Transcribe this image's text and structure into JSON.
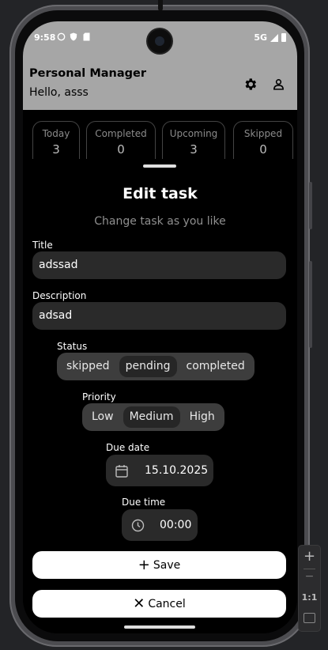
{
  "status_bar": {
    "time": "9:58",
    "network": "5G"
  },
  "app_bar": {
    "title": "Personal Manager",
    "greeting": "Hello, asss",
    "settings_icon": "gear-icon",
    "profile_icon": "person-icon"
  },
  "stats": [
    {
      "label": "Today",
      "count": "3"
    },
    {
      "label": "Completed",
      "count": "0"
    },
    {
      "label": "Upcoming",
      "count": "3"
    },
    {
      "label": "Skipped",
      "count": "0"
    }
  ],
  "sheet": {
    "title": "Edit task",
    "subtitle": "Change task as you like",
    "title_label": "Title",
    "title_value": "adssad",
    "description_label": "Description",
    "description_value": "adsad",
    "status_label": "Status",
    "status_options": [
      "skipped",
      "pending",
      "completed"
    ],
    "status_selected": "pending",
    "priority_label": "Priority",
    "priority_options": [
      "Low",
      "Medium",
      "High"
    ],
    "priority_selected": "Medium",
    "due_date_label": "Due date",
    "due_date_value": "15.10.2025",
    "due_time_label": "Due time",
    "due_time_value": "00:00",
    "save_label": "Save",
    "cancel_label": "Cancel"
  },
  "emulator_toolbar": {
    "zoom_in": "+",
    "zoom_out": "−",
    "ratio": "1:1"
  },
  "colors": {
    "app_bar": "#a6a6a6",
    "sheet_bg": "#000000",
    "field_bg": "#2a2a2a",
    "segment_bg": "#3d3d3d",
    "button_bg": "#ffffff"
  }
}
